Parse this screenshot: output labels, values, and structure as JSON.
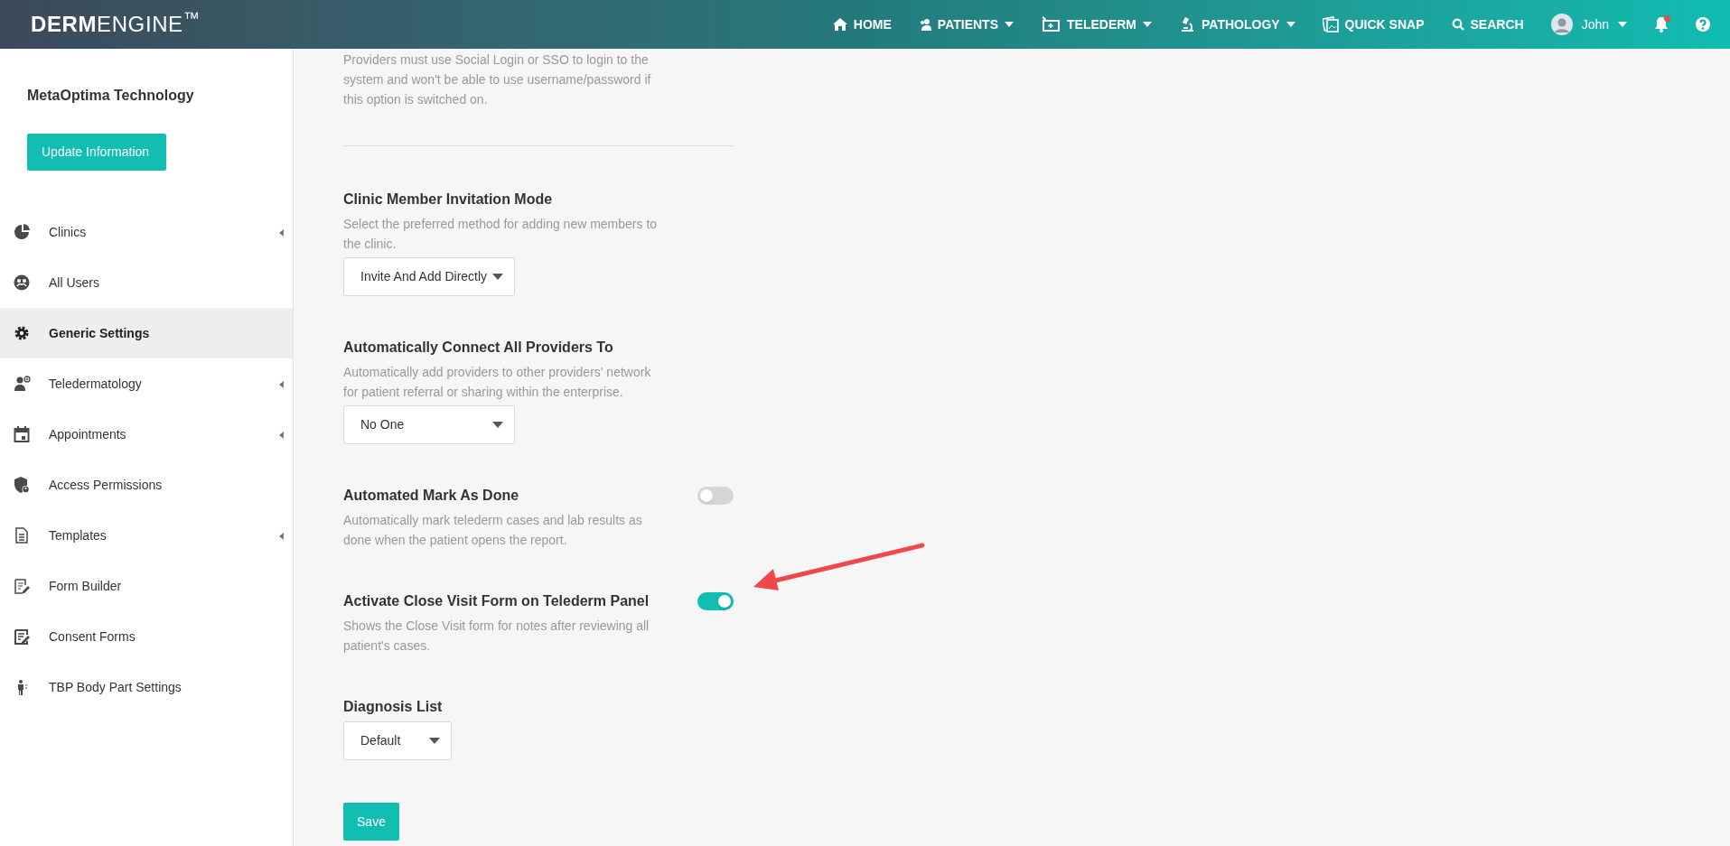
{
  "navbar": {
    "logo": "**DERM**ENGINE$^{™}$",
    "items": [
      {
        "label": "HOME",
        "dropdown": false
      },
      {
        "label": "PATIENTS",
        "dropdown": true
      },
      {
        "label": "TELEDERM",
        "dropdown": true
      },
      {
        "label": "PATHOLOGY",
        "dropdown": true
      },
      {
        "label": "QUICK SNAP",
        "dropdown": false
      },
      {
        "label": "SEARCH",
        "dropdown": false
      }
    ],
    "user": {
      "name": "John",
      "dropdown": true
    },
    "notifications": {
      "unread": true
    }
  },
  "sidebar": {
    "organization": "MetaOptima Technology",
    "update_button": "Update Information",
    "items": [
      {
        "label": "Clinics",
        "expandable": true,
        "selected": false
      },
      {
        "label": "All Users",
        "expandable": false,
        "selected": false
      },
      {
        "label": "Generic Settings",
        "expandable": false,
        "selected": true
      },
      {
        "label": "Teledermatology",
        "expandable": true,
        "selected": false
      },
      {
        "label": "Appointments",
        "expandable": true,
        "selected": false
      },
      {
        "label": "Access Permissions",
        "expandable": false,
        "selected": false
      },
      {
        "label": "Templates",
        "expandable": true,
        "selected": false
      },
      {
        "label": "Form Builder",
        "expandable": false,
        "selected": false
      },
      {
        "label": "Consent Forms",
        "expandable": false,
        "selected": false
      },
      {
        "label": "TBP Body Part Settings",
        "expandable": false,
        "selected": false
      }
    ]
  },
  "settings": {
    "intro": "Providers must use Social Login or SSO to login to the system and won't be able to use username/password if this option is switched on.",
    "sections": [
      {
        "kind": "select",
        "title": "Clinic Member Invitation Mode",
        "description": "Select the preferred method for adding new members to the clinic.",
        "value": "Invite And Add Directly"
      },
      {
        "kind": "select",
        "title": "Automatically Connect All Providers To",
        "description": "Automatically add providers to other providers' network for patient referral or sharing within the enterprise.",
        "value": "No One"
      },
      {
        "kind": "toggle",
        "title": "Automated Mark As Done",
        "description": "Automatically mark telederm cases and lab results as done when the patient opens the report.",
        "on": false
      },
      {
        "kind": "toggle",
        "title": "Activate Close Visit Form on Telederm Panel",
        "description": "Shows the Close Visit form for notes after reviewing all patient's cases.",
        "on": true
      },
      {
        "kind": "select",
        "title": "Diagnosis List",
        "value": "Default"
      }
    ],
    "save_button": "Save"
  }
}
